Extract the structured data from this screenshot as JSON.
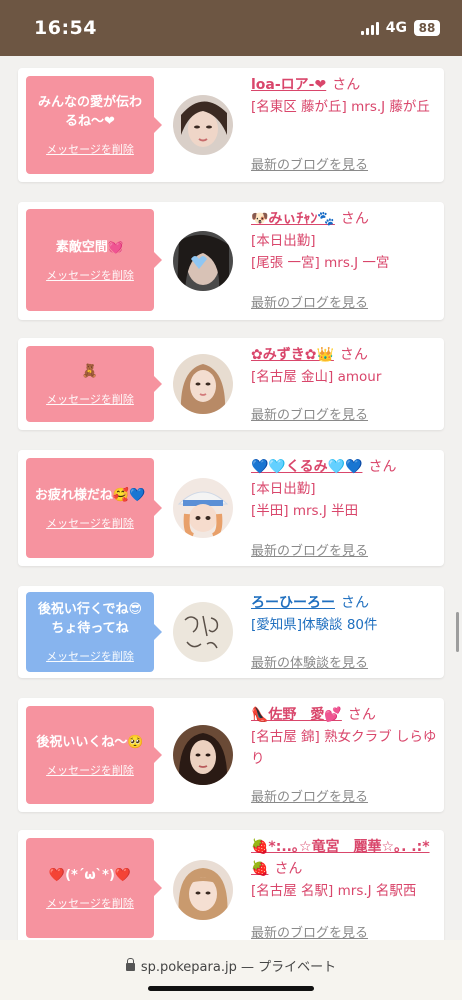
{
  "status": {
    "time": "16:54",
    "network": "4G",
    "battery": "88"
  },
  "delete_label": "メッセージを削除",
  "cards": [
    {
      "message": "みんなの愛が伝わるね〜❤",
      "name": "loa-ロア-❤",
      "san": "さん",
      "details": [
        "[名東区 藤が丘] mrs.J 藤が丘"
      ],
      "link": "最新のブログを見る"
    },
    {
      "message": "素敵空間💓",
      "name": "🐶みぃﾁｬﾝ🐾",
      "san": "さん",
      "details": [
        "[本日出勤]",
        "[尾張 一宮] mrs.J 一宮"
      ],
      "link": "最新のブログを見る"
    },
    {
      "message": "🧸",
      "name": "✿みずき✿👑",
      "san": "さん",
      "details": [
        "[名古屋 金山] amour"
      ],
      "link": "最新のブログを見る"
    },
    {
      "message": "お疲れ様だね🥰💙",
      "name": "💙🩵くるみ🩵💙",
      "san": "さん",
      "details": [
        "[本日出勤]",
        "[半田] mrs.J 半田"
      ],
      "link": "最新のブログを見る"
    },
    {
      "message": "後祝い行くでね😎ちょ待ってね",
      "name": "ろーひーろー",
      "san": "さん",
      "details": [
        "[愛知県]体験談 80件"
      ],
      "link": "最新の体験談を見る",
      "style": "blue"
    },
    {
      "message": "後祝いいくね〜🥺",
      "name": "👠佐野　愛💕",
      "san": "さん",
      "details": [
        "[名古屋 錦] 熟女クラブ しらゆり"
      ],
      "link": "最新のブログを見る"
    },
    {
      "message": "❤️(*´ω`*)❤️",
      "name": "🍓*:..｡☆竜宮　麗華☆｡. .:*🍓",
      "san": "さん",
      "details": [
        "[名古屋 名駅] mrs.J 名駅西"
      ],
      "link": "最新のブログを見る"
    }
  ],
  "url_bar": {
    "domain": "sp.pokepara.jp",
    "suffix": "— プライベート"
  },
  "colors": {
    "pink_bubble": "#f6939f",
    "blue_bubble": "#87b4ee",
    "name_pink": "#d9466b",
    "name_blue": "#1f6fbf",
    "status_bar": "#6d5643"
  }
}
